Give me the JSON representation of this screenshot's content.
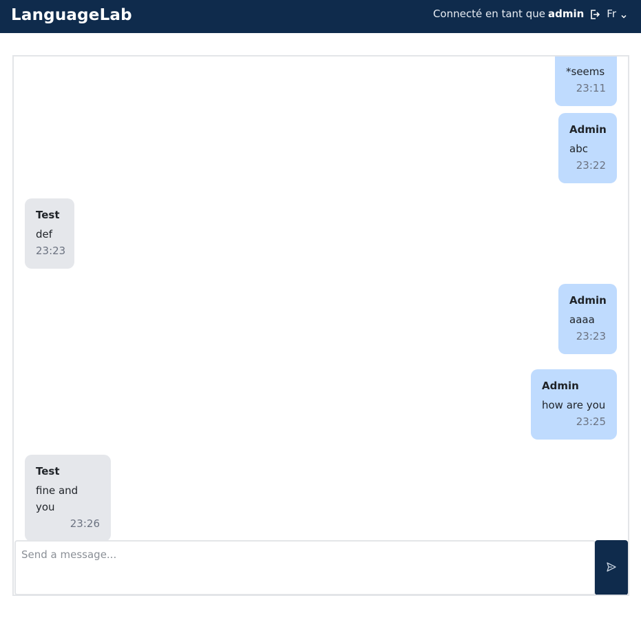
{
  "header": {
    "app_title": "LanguageLab",
    "logged_in_prefix": "Connecté en tant que",
    "username": "admin",
    "language": "Fr"
  },
  "messages": [
    {
      "sender": "",
      "text": "*seems",
      "time": "23:11",
      "mine": true
    },
    {
      "sender": "Admin",
      "text": "abc",
      "time": "23:22",
      "mine": true
    },
    {
      "sender": "Test",
      "text": "def",
      "time": "23:23",
      "mine": false
    },
    {
      "sender": "Admin",
      "text": "aaaa",
      "time": "23:23",
      "mine": true
    },
    {
      "sender": "Admin",
      "text": "how are you",
      "time": "23:25",
      "mine": true
    },
    {
      "sender": "Test",
      "text": "fine and you",
      "time": "23:26",
      "mine": false
    }
  ],
  "composer": {
    "placeholder": "Send a message..."
  },
  "colors": {
    "topbar": "#0f2b4c",
    "my_bubble": "#bfdbfe",
    "their_bubble": "#e5e7eb"
  }
}
